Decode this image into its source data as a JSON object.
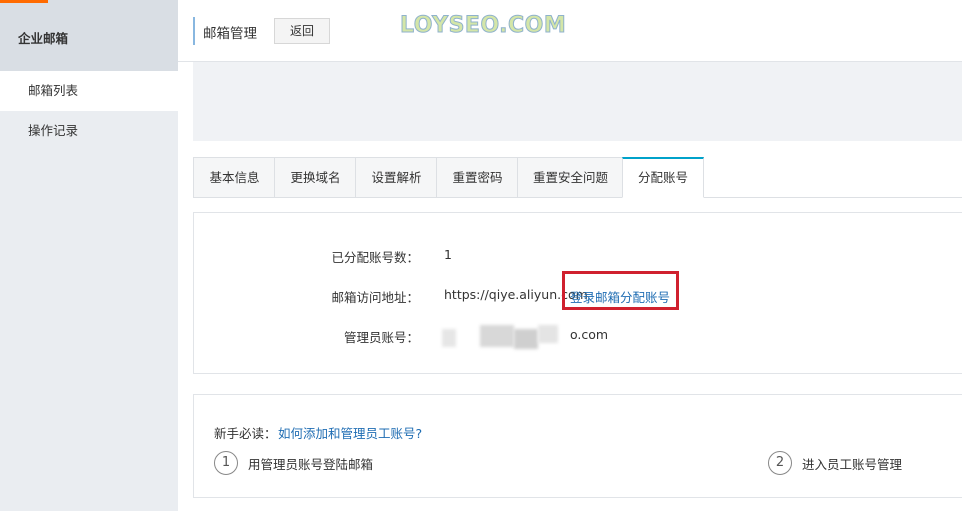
{
  "sidebar": {
    "title": "企业邮箱",
    "items": [
      {
        "label": "邮箱列表",
        "active": true
      },
      {
        "label": "操作记录",
        "active": false
      }
    ]
  },
  "header": {
    "title": "邮箱管理",
    "back_label": "返回",
    "watermark": "LOYSEO.COM"
  },
  "tabs": [
    {
      "label": "基本信息",
      "active": false
    },
    {
      "label": "更换域名",
      "active": false
    },
    {
      "label": "设置解析",
      "active": false
    },
    {
      "label": "重置密码",
      "active": false
    },
    {
      "label": "重置安全问题",
      "active": false
    },
    {
      "label": "分配账号",
      "active": true
    }
  ],
  "info": {
    "assigned_count_label": "已分配账号数：",
    "assigned_count_value": "1",
    "access_url_label": "邮箱访问地址：",
    "access_url_value": "https://qiye.aliyun.com",
    "login_link": "登录邮箱分配账号",
    "admin_account_label": "管理员账号：",
    "admin_account_suffix": "o.com"
  },
  "help": {
    "label": "新手必读：",
    "link": "如何添加和管理员工账号?",
    "steps": [
      {
        "num": "1",
        "text": "用管理员账号登陆邮箱"
      },
      {
        "num": "2",
        "text": "进入员工账号管理"
      }
    ]
  },
  "colors": {
    "accent_orange": "#ff6a00",
    "tab_active_top": "#00a2ca",
    "link_blue": "#1f6db3",
    "highlight_red": "#d0202e",
    "sidebar_bg": "#eaedf1"
  }
}
